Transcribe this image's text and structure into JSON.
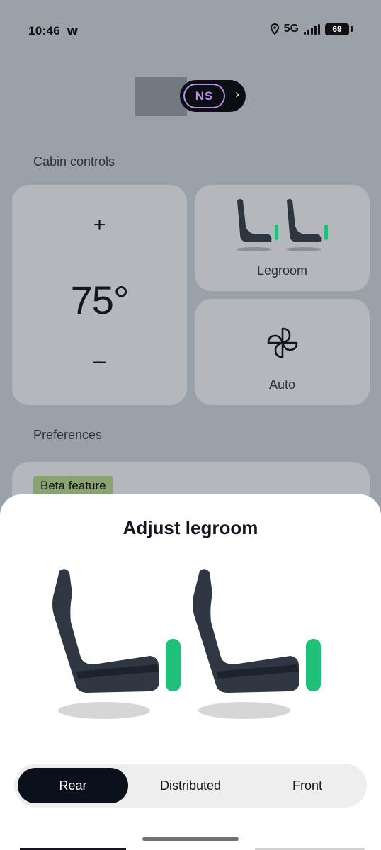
{
  "status_bar": {
    "time": "10:46",
    "carrier_glyph": "w",
    "network": "5G",
    "battery": "69",
    "icons": [
      "location-icon",
      "signal-icon",
      "battery-icon"
    ]
  },
  "vehicle": {
    "badge": "NS",
    "chevron": "›",
    "accent_color": "#b98de4"
  },
  "cabin": {
    "section_title": "Cabin controls",
    "temperature": {
      "increase": "+",
      "value": "75°",
      "decrease": "–"
    },
    "legroom_label": "Legroom",
    "fan_label": "Auto"
  },
  "preferences": {
    "section_title": "Preferences",
    "beta_badge": "Beta feature"
  },
  "sheet": {
    "title": "Adjust legroom",
    "indicator_color": "#1fc07a",
    "options": [
      "Rear",
      "Distributed",
      "Front"
    ],
    "selected": "Rear"
  }
}
